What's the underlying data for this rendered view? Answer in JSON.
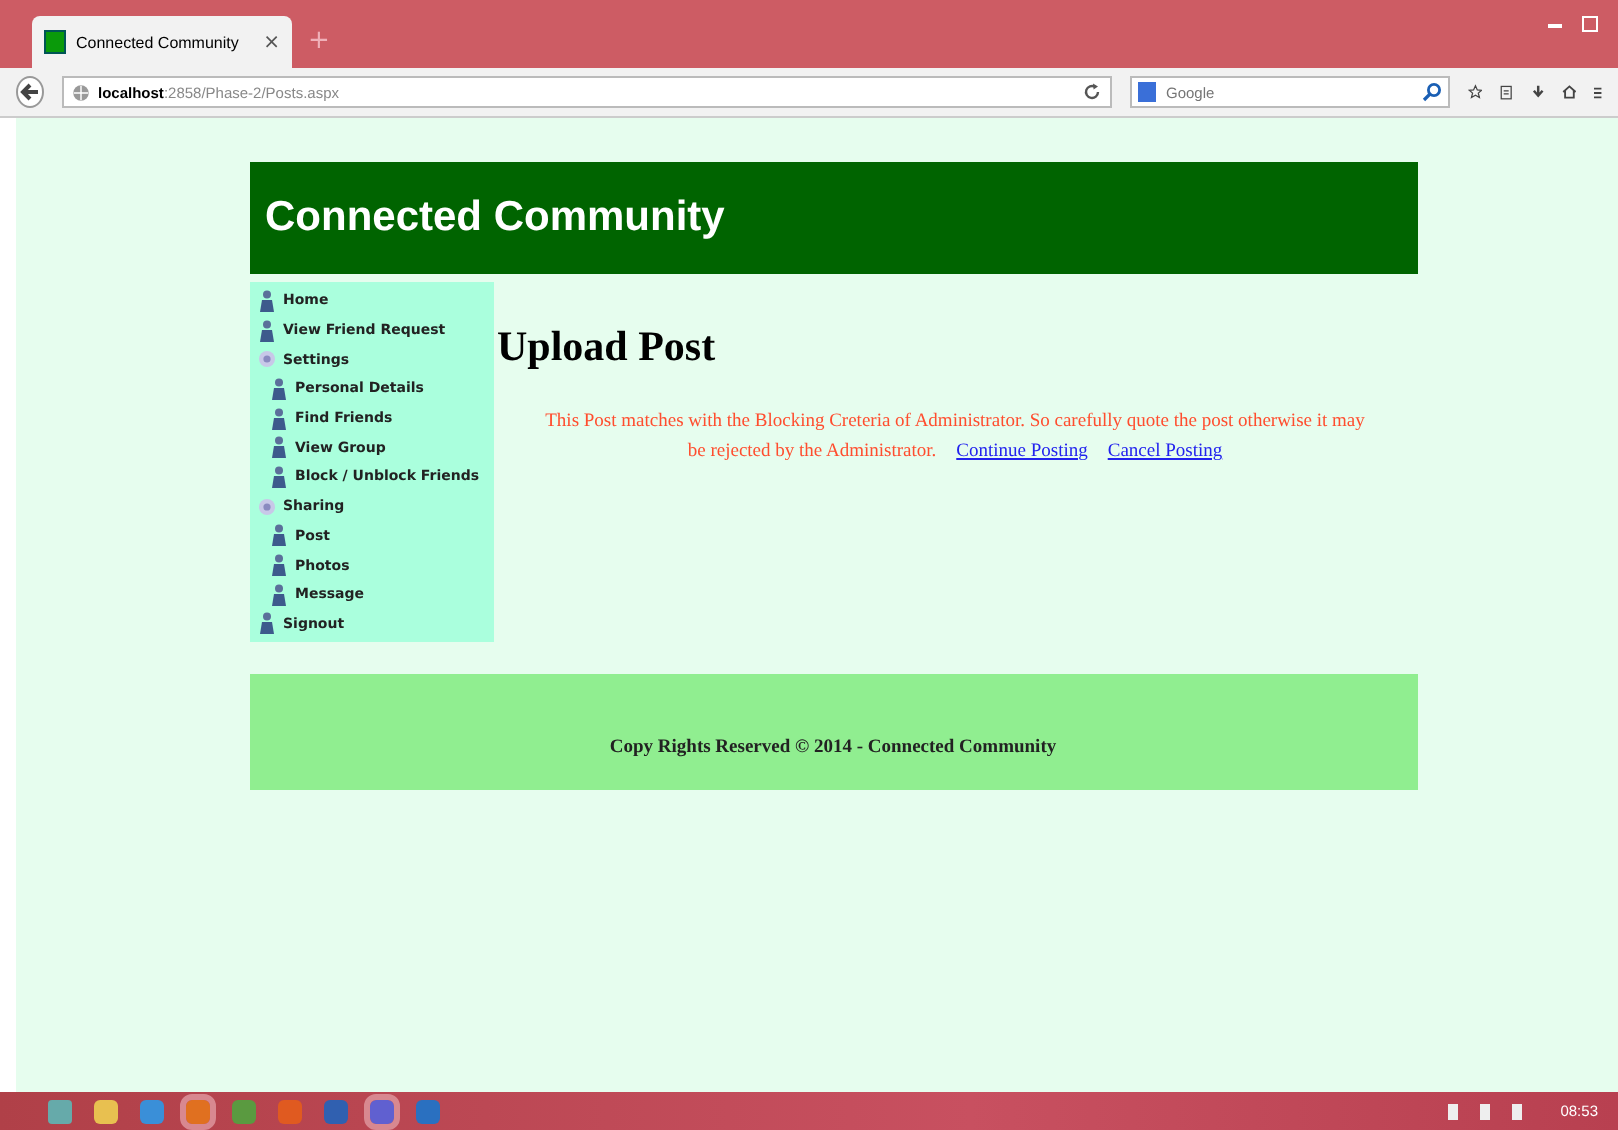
{
  "browser": {
    "tab_title": "Connected Community",
    "tab_close": "×",
    "new_tab": "+",
    "url_host": "localhost",
    "url_path": ":2858/Phase-2/Posts.aspx",
    "search_placeholder": "Google"
  },
  "header": {
    "title": "Connected Community"
  },
  "menu": [
    {
      "label": "Home",
      "kind": "page"
    },
    {
      "label": "View Friend Request",
      "kind": "page"
    },
    {
      "label": "Settings",
      "kind": "group",
      "children": [
        {
          "label": "Personal Details",
          "kind": "page"
        },
        {
          "label": "Find Friends",
          "kind": "page"
        },
        {
          "label": "View Group",
          "kind": "page"
        },
        {
          "label": "Block / Unblock Friends",
          "kind": "page"
        }
      ]
    },
    {
      "label": "Sharing",
      "kind": "group",
      "children": [
        {
          "label": "Post",
          "kind": "page"
        },
        {
          "label": "Photos",
          "kind": "page"
        },
        {
          "label": "Message",
          "kind": "page"
        }
      ]
    },
    {
      "label": "Signout",
      "kind": "page"
    }
  ],
  "content": {
    "heading": "Upload Post",
    "message": "This Post matches with the Blocking Creteria of Administrator. So carefully quote the post otherwise it may be rejected by the Administrator.",
    "links": [
      "Continue Posting",
      "Cancel Posting"
    ]
  },
  "footer": {
    "text": "Copy Rights Reserved © 2014 - Connected Community"
  },
  "taskbar": {
    "clock": "08:53"
  }
}
